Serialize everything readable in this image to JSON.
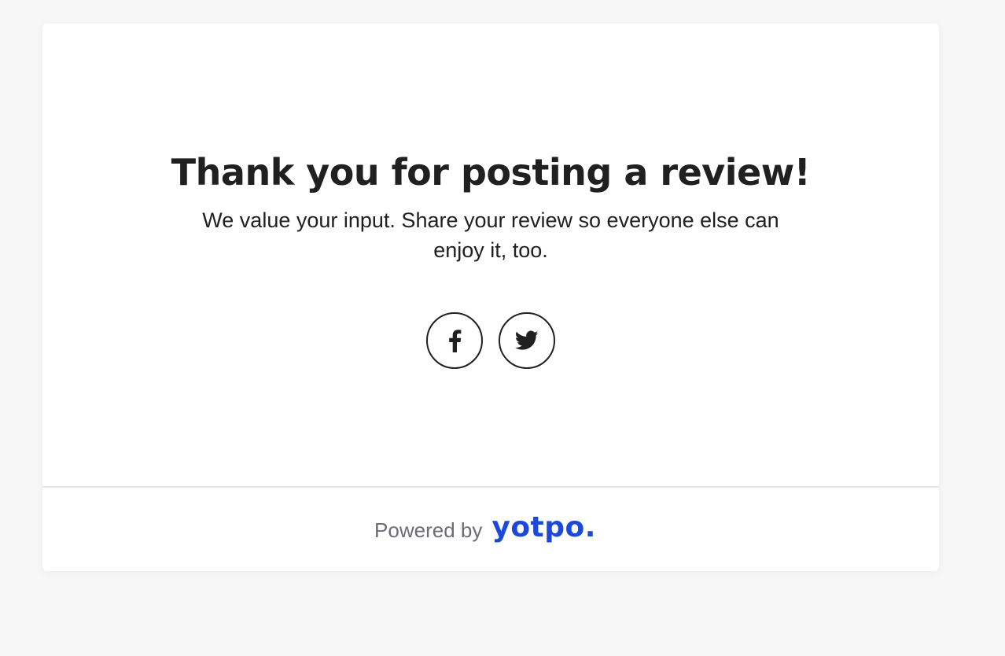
{
  "card": {
    "title": "Thank you for posting a review!",
    "subtitle": "We value your input. Share your review so everyone else can enjoy it, too."
  },
  "share": {
    "buttons": [
      {
        "network": "Facebook",
        "icon": "facebook-icon"
      },
      {
        "network": "Twitter",
        "icon": "twitter-icon"
      }
    ]
  },
  "footer": {
    "powered_by": "Powered by",
    "brand": "yotpo.",
    "brand_color": "#1a49db"
  },
  "colors": {
    "background": "#f7f7f8",
    "card": "#ffffff",
    "text": "#202020",
    "muted": "#6c6c78"
  }
}
